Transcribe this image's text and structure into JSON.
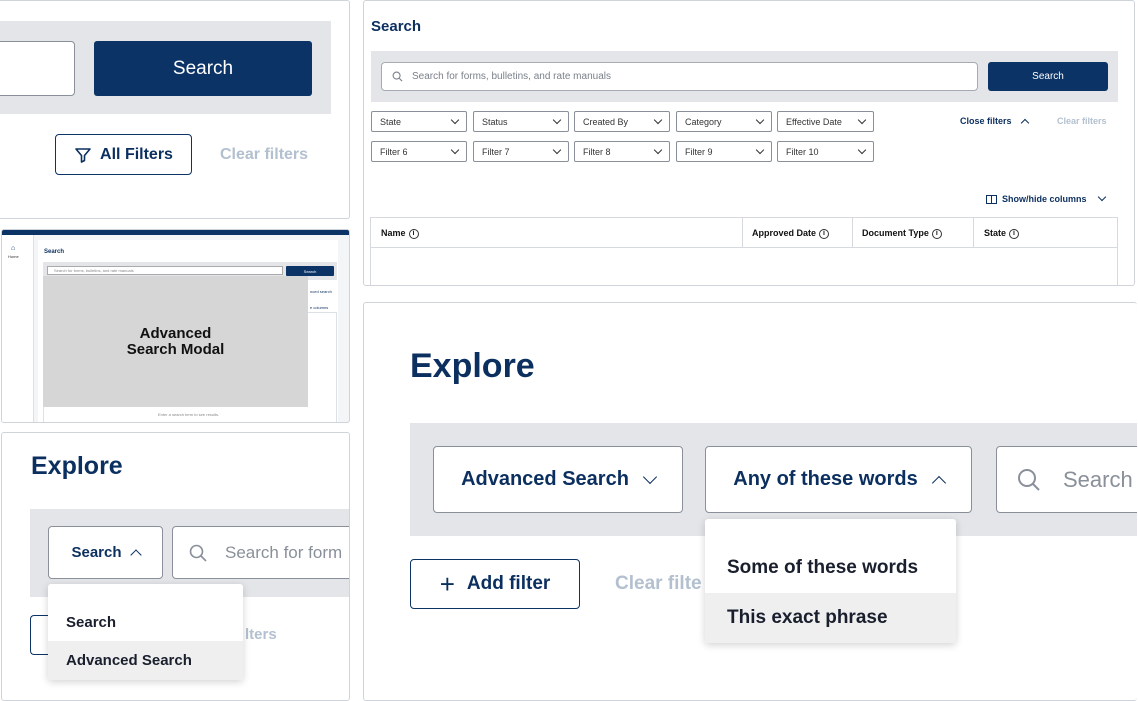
{
  "p1": {
    "search_btn": "Search",
    "all_filters": "All Filters",
    "clear_filters": "Clear filters"
  },
  "p2": {
    "title": "Search",
    "search_placeholder": "Search for forms, bulletins, and rate manuals",
    "search_btn": "Search",
    "filters_row1": [
      "State",
      "Status",
      "Created By",
      "Category",
      "Effective Date"
    ],
    "filters_row2": [
      "Filter 6",
      "Filter 7",
      "Filter 8",
      "Filter 9",
      "Filter 10"
    ],
    "close_filters": "Close filters",
    "clear_filters": "Clear filters",
    "show_hide": "Show/hide columns",
    "columns": [
      "Name",
      "Approved Date",
      "Document Type",
      "State"
    ]
  },
  "p3": {
    "home": "Home",
    "title": "Search",
    "placeholder": "Search for forms, bulletins, and rate manuals",
    "search_btn": "Search",
    "modal_label": "Advanced\nSearch Modal",
    "frag1": "nced search",
    "frag2": "e columns",
    "hint": "Enter a search term to see results."
  },
  "p4": {
    "title": "Explore",
    "dropdown": "Search",
    "placeholder": "Search for form",
    "menu": [
      "Search",
      "Advanced Search"
    ],
    "clear_frag": "lters"
  },
  "p5": {
    "title": "Explore",
    "adv_dropdown": "Advanced Search",
    "words_dropdown": "Any of these words",
    "search_frag": "Search",
    "add_filter": "Add filter",
    "clear_frag": "Clear filte",
    "menu": [
      "Some of these words",
      "This exact phrase"
    ]
  }
}
